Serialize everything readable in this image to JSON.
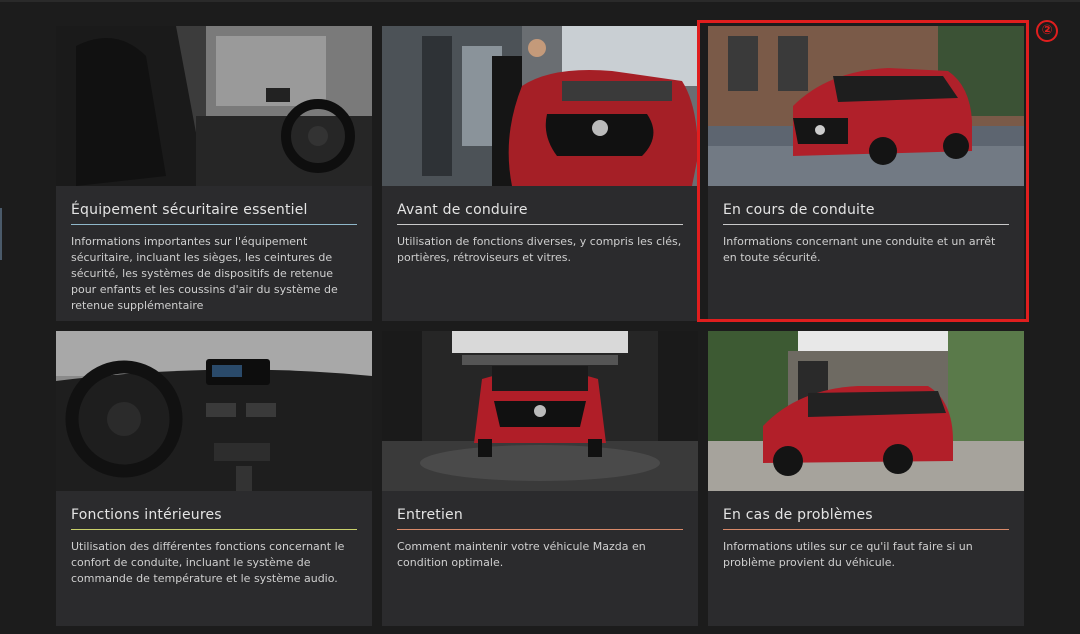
{
  "cards": [
    {
      "title": "Équipement sécuritaire essentiel",
      "description": "Informations importantes sur l'équipement sécuritaire, incluant les sièges, les ceintures de sécurité, les systèmes de dispositifs de retenue pour enfants et les coussins d'air du système de retenue supplémentaire",
      "image": "car-interior-seats-image",
      "accent": "#8fb7c9"
    },
    {
      "title": "Avant de conduire",
      "description": "Utilisation de fonctions diverses, y compris les clés, portières, rétroviseurs et vitres.",
      "image": "man-opening-red-suv-image",
      "accent": "#c9c9c9"
    },
    {
      "title": "En cours de conduite",
      "description": "Informations concernant une conduite et un arrêt en toute sécurité.",
      "image": "red-suv-driving-street-image",
      "accent": "#c9c9c9"
    },
    {
      "title": "Fonctions intérieures",
      "description": "Utilisation des différentes fonctions concernant le confort de conduite, incluant le système de commande de température et le système audio.",
      "image": "dashboard-steering-wheel-image",
      "accent": "#c9d06b"
    },
    {
      "title": "Entretien",
      "description": "Comment maintenir votre véhicule Mazda en condition optimale.",
      "image": "red-suv-garage-front-image",
      "accent": "#d98a6a"
    },
    {
      "title": "En cas de problèmes",
      "description": "Informations utiles sur ce qu'il faut faire si un problème provient du véhicule.",
      "image": "red-suv-parked-image",
      "accent": "#d98a6a"
    }
  ],
  "highlight": {
    "marker": "②",
    "color": "#e01e1e"
  }
}
